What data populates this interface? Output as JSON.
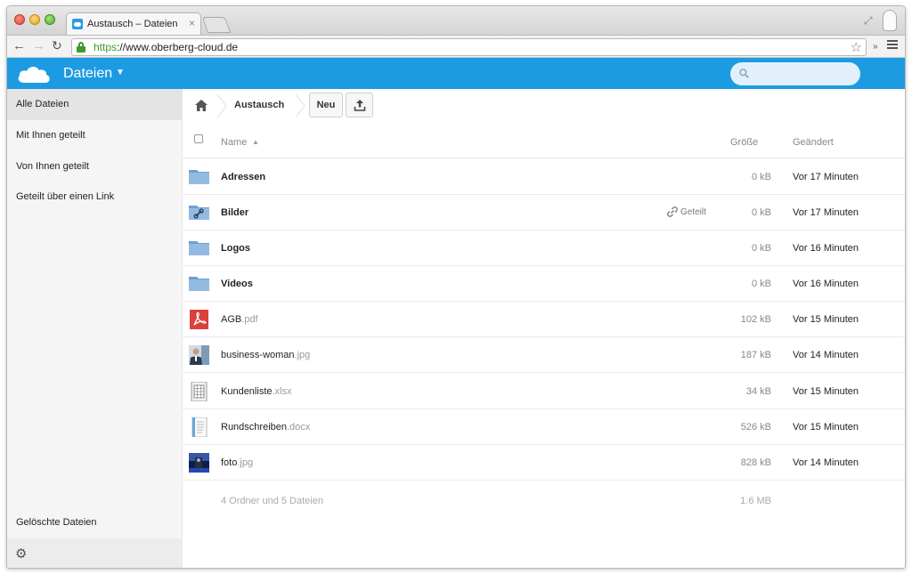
{
  "browser": {
    "tab_title": "Austausch – Dateien",
    "tab_close": "×",
    "url_scheme": "https",
    "url_rest": "://www.oberberg-cloud.de"
  },
  "app": {
    "title": "Dateien",
    "search": {
      "value": "",
      "placeholder": ""
    }
  },
  "sidebar": {
    "items": [
      {
        "label": "Alle Dateien",
        "active": true
      },
      {
        "label": "Mit Ihnen geteilt"
      },
      {
        "label": "Von Ihnen geteilt"
      },
      {
        "label": "Geteilt über einen Link"
      }
    ],
    "deleted": "Gelöschte Dateien"
  },
  "breadcrumb": {
    "current": "Austausch"
  },
  "controls": {
    "new_label": "Neu"
  },
  "table": {
    "headers": {
      "name": "Name",
      "size": "Größe",
      "modified": "Geändert"
    },
    "rows": [
      {
        "name": "Adressen",
        "ext": "",
        "type": "folder",
        "size": "0 kB",
        "modified": "Vor 17 Minuten"
      },
      {
        "name": "Bilder",
        "ext": "",
        "type": "folder-shared",
        "shared": "Geteilt",
        "size": "0 kB",
        "modified": "Vor 17 Minuten"
      },
      {
        "name": "Logos",
        "ext": "",
        "type": "folder",
        "size": "0 kB",
        "modified": "Vor 16 Minuten"
      },
      {
        "name": "Videos",
        "ext": "",
        "type": "folder",
        "size": "0 kB",
        "modified": "Vor 16 Minuten"
      },
      {
        "name": "AGB",
        "ext": ".pdf",
        "type": "pdf",
        "size": "102 kB",
        "modified": "Vor 15 Minuten"
      },
      {
        "name": "business-woman",
        "ext": ".jpg",
        "type": "image",
        "size": "187 kB",
        "modified": "Vor 14 Minuten"
      },
      {
        "name": "Kundenliste",
        "ext": ".xlsx",
        "type": "spreadsheet",
        "size": "34 kB",
        "modified": "Vor 15 Minuten"
      },
      {
        "name": "Rundschreiben",
        "ext": ".docx",
        "type": "document",
        "size": "526 kB",
        "modified": "Vor 15 Minuten"
      },
      {
        "name": "foto",
        "ext": ".jpg",
        "type": "photo",
        "size": "828 kB",
        "modified": "Vor 14 Minuten"
      }
    ],
    "summary": {
      "text": "4 Ordner und 5 Dateien",
      "size": "1.6 MB"
    }
  },
  "colors": {
    "header": "#1d9be2",
    "url_secure": "#3a9d2a",
    "folder": "#7fa9d3"
  }
}
